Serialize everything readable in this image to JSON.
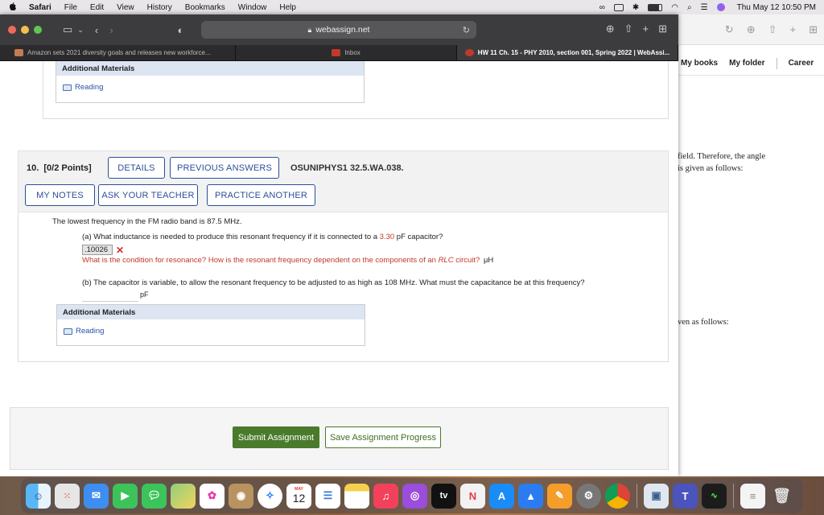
{
  "menubar": {
    "app": "Safari",
    "items": [
      "File",
      "Edit",
      "View",
      "History",
      "Bookmarks",
      "Window",
      "Help"
    ],
    "clock": "Thu May 12  10:50 PM"
  },
  "browser": {
    "url": "webassign.net",
    "tabs": [
      {
        "label": "Amazon sets 2021 diversity goals and releases new workforce...",
        "color": "#c57b53"
      },
      {
        "label": "Inbox",
        "color": "#c0392b"
      },
      {
        "label": "HW 11 Ch. 15 - PHY 2010, section 001, Spring 2022 | WebAssi...",
        "color": "#c0392b"
      }
    ]
  },
  "background_page": {
    "nav": [
      "My books",
      "My folder",
      "Career"
    ],
    "text1": "field. Therefore, the angle",
    "text2": "is given as follows:",
    "text3": "ven as follows:"
  },
  "prev_materials": {
    "header": "Additional Materials",
    "link": "Reading"
  },
  "question": {
    "number": "10.",
    "points": "[0/2 Points]",
    "details": "DETAILS",
    "previous_answers": "PREVIOUS ANSWERS",
    "code": "OSUNIPHYS1 32.5.WA.038.",
    "my_notes": "MY NOTES",
    "ask_teacher": "ASK YOUR TEACHER",
    "practice": "PRACTICE ANOTHER",
    "intro": "The lowest frequency in the FM radio band is 87.5 MHz.",
    "part_a_pre": "(a) What inductance is needed to produce this resonant frequency if it is connected to a ",
    "part_a_value": "3.30",
    "part_a_post": " pF capacitor?",
    "answer_a": ".10026",
    "hint": "What is the condition for resonance? How is the resonant frequency dependent on the components of an ",
    "hint_rlc": "RLC",
    "hint_end": " circuit?",
    "unit_a": "µH",
    "part_b": "(b) The capacitor is variable, to allow the resonant frequency to be adjusted to as high as 108 MHz. What must the capacitance be at this frequency?",
    "unit_b": "pF"
  },
  "materials": {
    "header": "Additional Materials",
    "link": "Reading"
  },
  "actions": {
    "submit": "Submit Assignment",
    "save": "Save Assignment Progress"
  },
  "dock": {
    "calendar_month": "MAY",
    "calendar_day": "12",
    "tv": "tv",
    "apps": [
      "finder-icon",
      "launchpad-icon",
      "mail-icon",
      "facetime-icon",
      "messages-icon",
      "maps-icon",
      "photos-icon",
      "contacts-icon",
      "safari-icon",
      "calendar-icon",
      "reminders-icon",
      "notes-icon",
      "music-icon",
      "podcasts-icon",
      "tv-icon",
      "news-icon",
      "appstore-icon",
      "keynote-icon",
      "pages-icon",
      "system-preferences-icon",
      "chrome-icon",
      "preview-icon",
      "teams-icon",
      "activity-monitor-icon",
      "documents-icon",
      "trash-icon"
    ]
  }
}
